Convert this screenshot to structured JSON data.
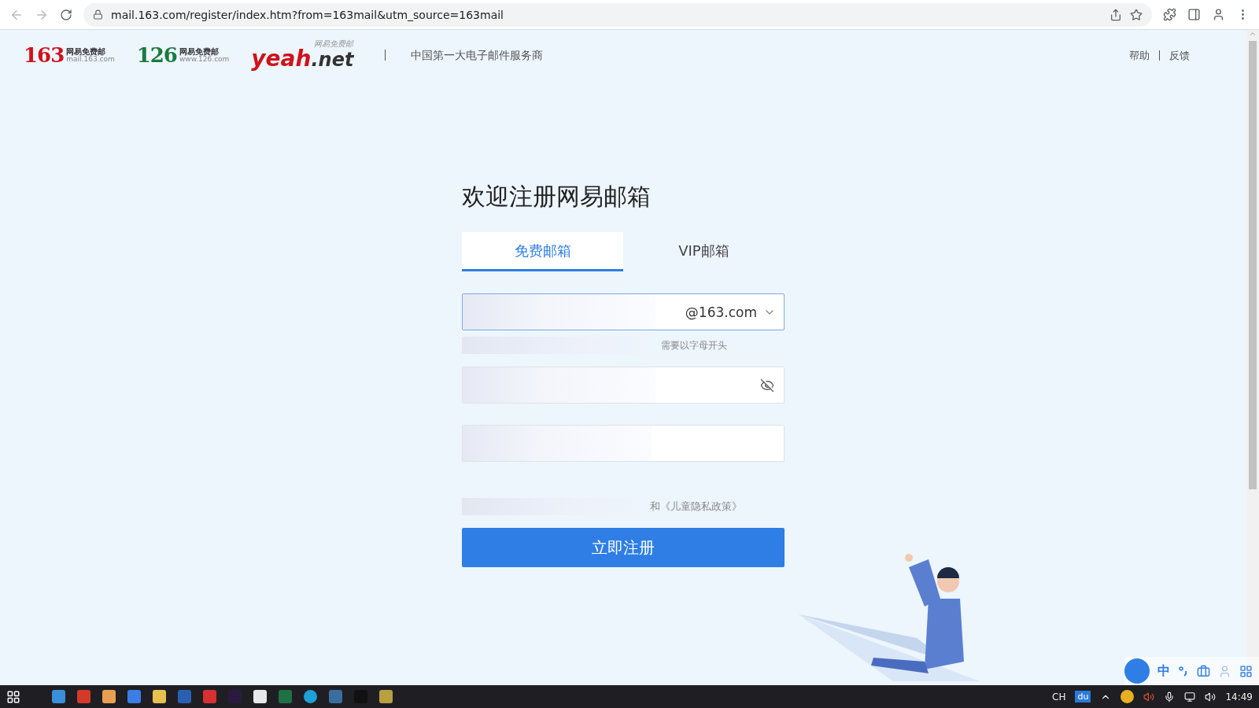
{
  "browser": {
    "url": "mail.163.com/register/index.htm?from=163mail&utm_source=163mail"
  },
  "header": {
    "brands": [
      {
        "number": "163",
        "name": "网易免费邮",
        "domain": "mail.163.com",
        "color": "#d0121b"
      },
      {
        "number": "126",
        "name": "网易免费邮",
        "domain": "www.126.com",
        "color": "#1b7a3e"
      }
    ],
    "yeah": {
      "main": "yeah",
      "suffix": ".net",
      "tag": "网易免费邮"
    },
    "slogan": "中国第一大电子邮件服务商",
    "links": [
      "帮助",
      "反馈"
    ]
  },
  "form": {
    "title": "欢迎注册网易邮箱",
    "tabs": [
      {
        "label": "免费邮箱",
        "selected": true
      },
      {
        "label": "VIP邮箱",
        "selected": false
      }
    ],
    "domain": "@163.com",
    "hint": "需要以字母开头",
    "agreement": "和《儿童隐私政策》",
    "submit": "立即注册"
  },
  "ime_bar": {
    "mode": "中"
  },
  "taskbar": {
    "language": "CH",
    "baidu_badge": "du",
    "clock": "14:49"
  }
}
